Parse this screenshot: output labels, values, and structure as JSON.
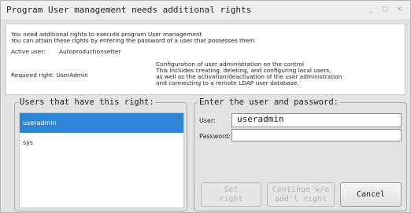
{
  "window": {
    "title": "Program User management needs additional rights",
    "controls": [
      "minimize-icon",
      "maximize-icon",
      "close-icon"
    ]
  },
  "info": {
    "line1": "You need additional rights to execute program User management",
    "line2": "You can attain these rights by entering the password of a user that possesses them",
    "active_user_label": "Active user:",
    "active_user_value": "Autoproductionsetter",
    "required_right": "Required right: UserAdmin",
    "description": [
      "Configuration of user administration on the control",
      "This includes creating, deleting, and configuring local users,",
      "as well as the activation/deactivation of the user administration",
      "and connecting to a remote LDAP user database."
    ]
  },
  "users_panel": {
    "legend": "Users that have this right:",
    "items": [
      {
        "label": "useradmin",
        "selected": true
      },
      {
        "label": "sys",
        "selected": false
      }
    ]
  },
  "login_panel": {
    "legend": "Enter the user and password:",
    "user_label": "User:",
    "user_value": "useradmin",
    "password_label": "Password:",
    "password_value": ""
  },
  "buttons": {
    "set_right": [
      "Set",
      "right"
    ],
    "continue": [
      "Continue w/o",
      "add'l right"
    ],
    "cancel": "Cancel"
  },
  "colors": {
    "selection": "#2d86d5",
    "background": "#e3e3e3"
  }
}
